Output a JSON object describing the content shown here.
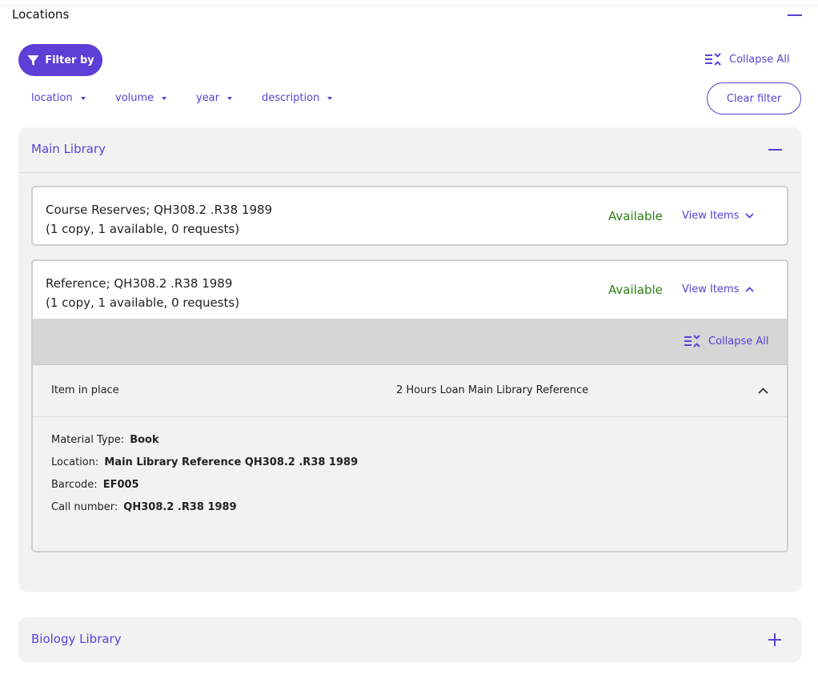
{
  "section": {
    "title": "Locations"
  },
  "filter": {
    "button_label": "Filter by",
    "collapse_all_label": "Collapse All",
    "clear_label": "Clear filter",
    "facets": [
      {
        "label": "location"
      },
      {
        "label": "volume"
      },
      {
        "label": "year"
      },
      {
        "label": "description"
      }
    ]
  },
  "libraries": [
    {
      "name": "Main Library",
      "expanded": true,
      "holdings": [
        {
          "title": "Course Reserves; QH308.2 .R38 1989",
          "summary": "(1 copy, 1 available, 0 requests)",
          "status": "Available",
          "view_items_label": "View Items",
          "expanded": false
        },
        {
          "title": "Reference; QH308.2 .R38 1989",
          "summary": "(1 copy, 1 available, 0 requests)",
          "status": "Available",
          "view_items_label": "View Items",
          "expanded": true,
          "collapse_all_label": "Collapse All",
          "item": {
            "status": "Item in place",
            "policy": "2 Hours Loan Main Library Reference",
            "details": [
              {
                "label": "Material Type:",
                "value": "Book"
              },
              {
                "label": "Location:",
                "value": "Main Library Reference QH308.2 .R38 1989"
              },
              {
                "label": "Barcode:",
                "value": "EF005"
              },
              {
                "label": "Call number:",
                "value": "QH308.2 .R38 1989"
              }
            ]
          }
        }
      ]
    },
    {
      "name": "Biology Library",
      "expanded": false
    }
  ],
  "colors": {
    "accent": "#5b3fd6",
    "available": "#2e7d14",
    "panel_bg": "#f2f2f2",
    "items_bar_bg": "#d6d6d6"
  },
  "icons": {
    "filter": "funnel-icon",
    "collapse_all": "collapse-all-icon",
    "facet_dropdown": "caret-down-icon",
    "collapse": "minus-icon",
    "expand": "plus-icon",
    "view_items_closed": "chevron-down-icon",
    "view_items_open": "chevron-up-icon"
  }
}
